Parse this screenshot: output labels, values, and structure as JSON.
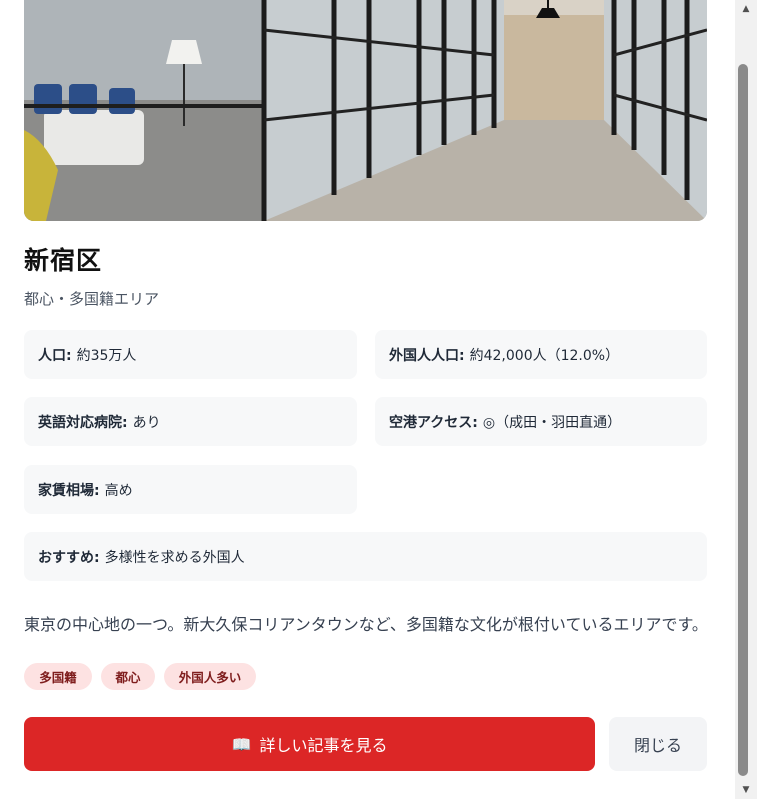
{
  "area": {
    "name": "新宿区",
    "subtitle": "都心・多国籍エリア",
    "image_alt": "Office corridor with glass partitions"
  },
  "facts": [
    {
      "label": "人口:",
      "value": "約35万人"
    },
    {
      "label": "外国人人口:",
      "value": "約42,000人（12.0%）"
    },
    {
      "label": "英語対応病院:",
      "value": "あり"
    },
    {
      "label": "空港アクセス:",
      "value": "◎（成田・羽田直通）"
    },
    {
      "label": "家賃相場:",
      "value": "高め"
    }
  ],
  "recommend": {
    "label": "おすすめ:",
    "value": "多様性を求める外国人"
  },
  "description": "東京の中心地の一つ。新大久保コリアンタウンなど、多国籍な文化が根付いているエリアです。",
  "tags": [
    "多国籍",
    "都心",
    "外国人多い"
  ],
  "buttons": {
    "primary_icon": "📖",
    "primary_label": "詳しい記事を見る",
    "close_label": "閉じる"
  },
  "colors": {
    "accent": "#dc2626",
    "tag_bg": "#fde2e2",
    "tag_text": "#7f1d1d",
    "card_bg": "#f7f8f9"
  },
  "scrollbar": {
    "up_icon": "▲",
    "down_icon": "▼"
  }
}
